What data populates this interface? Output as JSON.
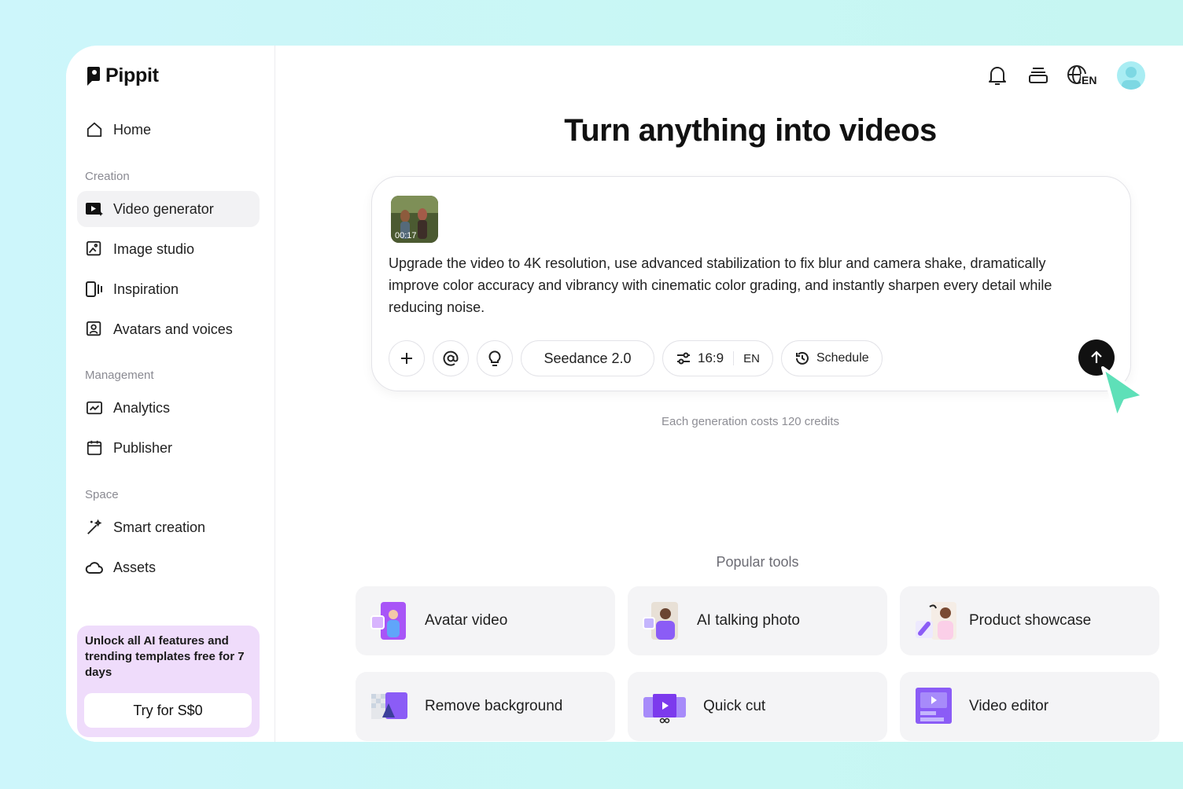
{
  "brand": {
    "name": "Pippit"
  },
  "sidebar": {
    "home": "Home",
    "sections": [
      {
        "label": "Creation",
        "items": [
          "Video generator",
          "Image studio",
          "Inspiration",
          "Avatars and voices"
        ]
      },
      {
        "label": "Management",
        "items": [
          "Analytics",
          "Publisher"
        ]
      },
      {
        "label": "Space",
        "items": [
          "Smart creation",
          "Assets"
        ]
      }
    ],
    "active_item": "Video generator",
    "promo": {
      "text": "Unlock all AI features and trending templates free for 7 days",
      "button": "Try for S$0"
    }
  },
  "topbar": {
    "language_badge": "EN"
  },
  "main": {
    "headline": "Turn anything into videos",
    "prompt": {
      "attachment_duration": "00:17",
      "text": "Upgrade the video to 4K resolution, use advanced stabilization to fix blur and camera shake, dramatically improve color accuracy and vibrancy with cinematic color grading, and instantly sharpen every detail while reducing noise.",
      "model": "Seedance 2.0",
      "aspect_ratio": "16:9",
      "language": "EN",
      "schedule": "Schedule"
    },
    "credits_note": "Each generation costs 120 credits",
    "popular_tools_title": "Popular tools",
    "popular_tools": [
      "Avatar video",
      "AI talking photo",
      "Product showcase",
      "Remove background",
      "Quick cut",
      "Video editor"
    ]
  },
  "colors": {
    "accent_purple": "#8b5cf6",
    "promo_bg": "#efdcfb",
    "cursor": "#5ee0b8"
  }
}
